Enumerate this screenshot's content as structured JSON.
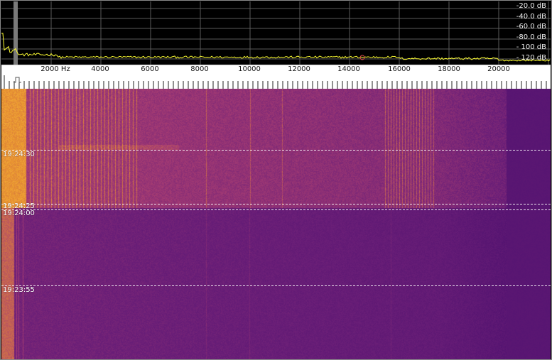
{
  "spectrum": {
    "db_labels": [
      "-20.0 dB",
      "-40.0 dB",
      "-60.0 dB",
      "-80.0 dB",
      "- 100 dB",
      "- 120 dB"
    ],
    "colors": {
      "background": "#000000",
      "grid": "#5a5a5a",
      "trace": "#ffff33",
      "marker": "#7a7a7a"
    }
  },
  "frequency_axis": {
    "labels": [
      "2000 Hz",
      "4000",
      "6000",
      "8000",
      "10000",
      "12000",
      "14000",
      "16000",
      "18000",
      "20000"
    ],
    "max_hz": 22000
  },
  "waterfall": {
    "timestamps": [
      "19:24:30",
      "19:24:25",
      "19:24:00",
      "19:23:55"
    ],
    "palette": [
      "#4b0f6e",
      "#6b1f78",
      "#a63c73",
      "#e8912f",
      "#ffd24a"
    ]
  }
}
